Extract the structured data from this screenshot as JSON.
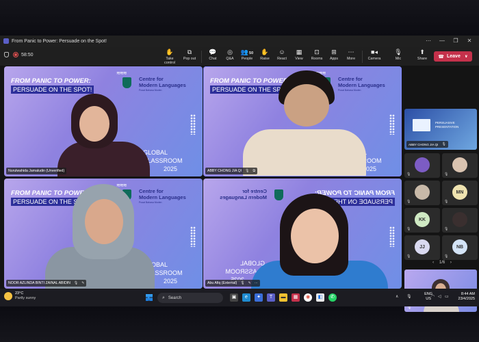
{
  "window": {
    "title": "From Panic to Power: Persuade on the Spot!",
    "controls": [
      "⋯",
      "—",
      "❐",
      "✕"
    ]
  },
  "toolbar": {
    "timer": "58:50",
    "buttons": [
      {
        "label": "Take control",
        "icon": "take-control-icon"
      },
      {
        "label": "Pop out",
        "icon": "pop-out-icon"
      },
      {
        "label": "Chat",
        "icon": "chat-icon"
      },
      {
        "label": "Q&A",
        "icon": "qa-icon"
      },
      {
        "label": "People",
        "icon": "people-icon",
        "badge": "50"
      },
      {
        "label": "Raise",
        "icon": "raise-hand-icon"
      },
      {
        "label": "React",
        "icon": "react-icon"
      },
      {
        "label": "View",
        "icon": "view-icon"
      },
      {
        "label": "Rooms",
        "icon": "rooms-icon"
      },
      {
        "label": "Apps",
        "icon": "apps-icon"
      },
      {
        "label": "More",
        "icon": "more-icon"
      },
      {
        "label": "Camera",
        "icon": "camera-icon"
      },
      {
        "label": "Mic",
        "icon": "mic-icon"
      },
      {
        "label": "Share",
        "icon": "share-icon"
      }
    ],
    "leave": "Leave"
  },
  "slide": {
    "title_line1": "FROM PANIC TO POWER:",
    "title_line2": "PERSUADE ON THE SPOT!",
    "org_line1": "Centre for",
    "org_line2": "Modern Languages",
    "org_sub": "Pusat Bahasa Moden",
    "event_line1": "GLOBAL CLASSROOM",
    "event_line2": "2025"
  },
  "participants": [
    {
      "name": "Nurulwahida Jamaludin (Unverified)"
    },
    {
      "name": "ABBY CHONG JIA QI"
    },
    {
      "name": "NOOR AZLINDA BINTI ZAINAL ABIDIN"
    },
    {
      "name": "Abu Afiq (External)"
    }
  ],
  "rail": {
    "presentation_line1": "PERSUASIVE",
    "presentation_line2": "PRESENTATION",
    "presenter": "ABBY CHONG JIA QI",
    "avatars": [
      {
        "initials": "",
        "color": "#7c5cc4"
      },
      {
        "initials": "",
        "color": "#d9c3b0"
      },
      {
        "initials": "",
        "color": "#c8b9a8"
      },
      {
        "initials": "MN",
        "color": "#efe3b0"
      },
      {
        "initials": "KK",
        "color": "#cfe9c3"
      },
      {
        "initials": "",
        "color": "#3a2f2f"
      },
      {
        "initials": "JJ",
        "color": "#d9d9f0"
      },
      {
        "initials": "NB",
        "color": "#d4e4f7"
      }
    ],
    "pager": "1/6"
  },
  "taskbar": {
    "temperature": "23°C",
    "weather": "Partly sunny",
    "search_placeholder": "Search",
    "lang1": "ENG",
    "lang2": "US",
    "time": "8:44 AM",
    "date": "23/4/2025"
  }
}
